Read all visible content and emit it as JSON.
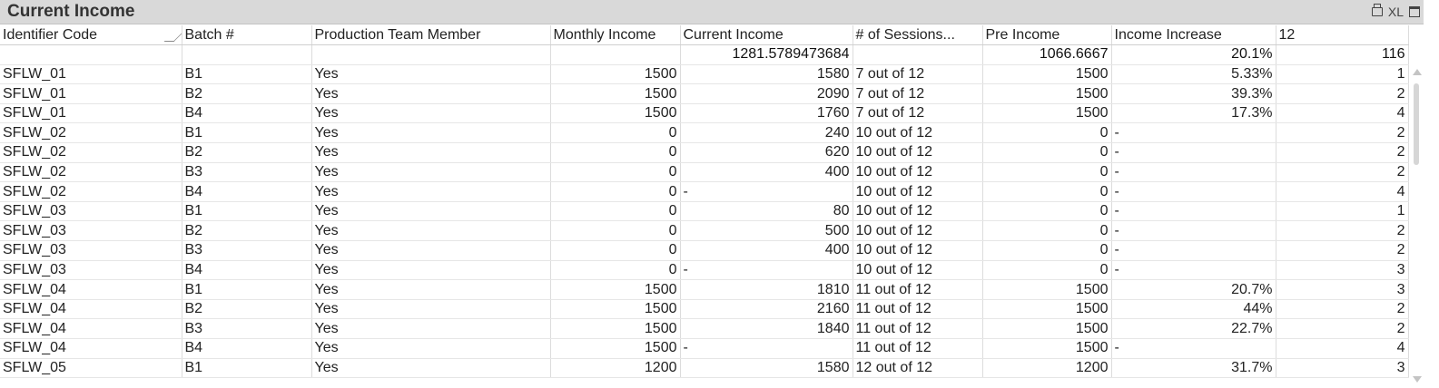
{
  "window": {
    "title": "Current Income",
    "xl_label": "XL",
    "icons": [
      "printer-icon",
      "xl-export-icon",
      "minimize-icon"
    ]
  },
  "table": {
    "columns": [
      "Identifier Code",
      "Batch #",
      "Production Team Member",
      "Monthly Income",
      "Current Income",
      "# of  Sessions...",
      "Pre Income",
      "Income Increase",
      "12"
    ],
    "totals": [
      "",
      "",
      "",
      "",
      "1281.5789473684",
      "",
      "1066.6667",
      "20.1%",
      "116"
    ],
    "rows": [
      [
        "SFLW_01",
        "B1",
        "Yes",
        "1500",
        "1580",
        "7 out of 12",
        "1500",
        "5.33%",
        "1"
      ],
      [
        "SFLW_01",
        "B2",
        "Yes",
        "1500",
        "2090",
        "7 out of 12",
        "1500",
        "39.3%",
        "2"
      ],
      [
        "SFLW_01",
        "B4",
        "Yes",
        "1500",
        "1760",
        "7 out of 12",
        "1500",
        "17.3%",
        "4"
      ],
      [
        "SFLW_02",
        "B1",
        "Yes",
        "0",
        "240",
        "10 out of 12",
        "0",
        "-",
        "2"
      ],
      [
        "SFLW_02",
        "B2",
        "Yes",
        "0",
        "620",
        "10 out of 12",
        "0",
        "-",
        "2"
      ],
      [
        "SFLW_02",
        "B3",
        "Yes",
        "0",
        "400",
        "10 out of 12",
        "0",
        "-",
        "2"
      ],
      [
        "SFLW_02",
        "B4",
        "Yes",
        "0",
        "-",
        "10 out of 12",
        "0",
        "-",
        "4"
      ],
      [
        "SFLW_03",
        "B1",
        "Yes",
        "0",
        "80",
        "10 out of 12",
        "0",
        "-",
        "1"
      ],
      [
        "SFLW_03",
        "B2",
        "Yes",
        "0",
        "500",
        "10 out of 12",
        "0",
        "-",
        "2"
      ],
      [
        "SFLW_03",
        "B3",
        "Yes",
        "0",
        "400",
        "10 out of 12",
        "0",
        "-",
        "2"
      ],
      [
        "SFLW_03",
        "B4",
        "Yes",
        "0",
        "-",
        "10 out of 12",
        "0",
        "-",
        "3"
      ],
      [
        "SFLW_04",
        "B1",
        "Yes",
        "1500",
        "1810",
        "11 out of 12",
        "1500",
        "20.7%",
        "3"
      ],
      [
        "SFLW_04",
        "B2",
        "Yes",
        "1500",
        "2160",
        "11 out of 12",
        "1500",
        "44%",
        "2"
      ],
      [
        "SFLW_04",
        "B3",
        "Yes",
        "1500",
        "1840",
        "11 out of 12",
        "1500",
        "22.7%",
        "2"
      ],
      [
        "SFLW_04",
        "B4",
        "Yes",
        "1500",
        "-",
        "11 out of 12",
        "1500",
        "-",
        "4"
      ],
      [
        "SFLW_05",
        "B1",
        "Yes",
        "1200",
        "1580",
        "12 out of 12",
        "1200",
        "31.7%",
        "3"
      ]
    ]
  }
}
